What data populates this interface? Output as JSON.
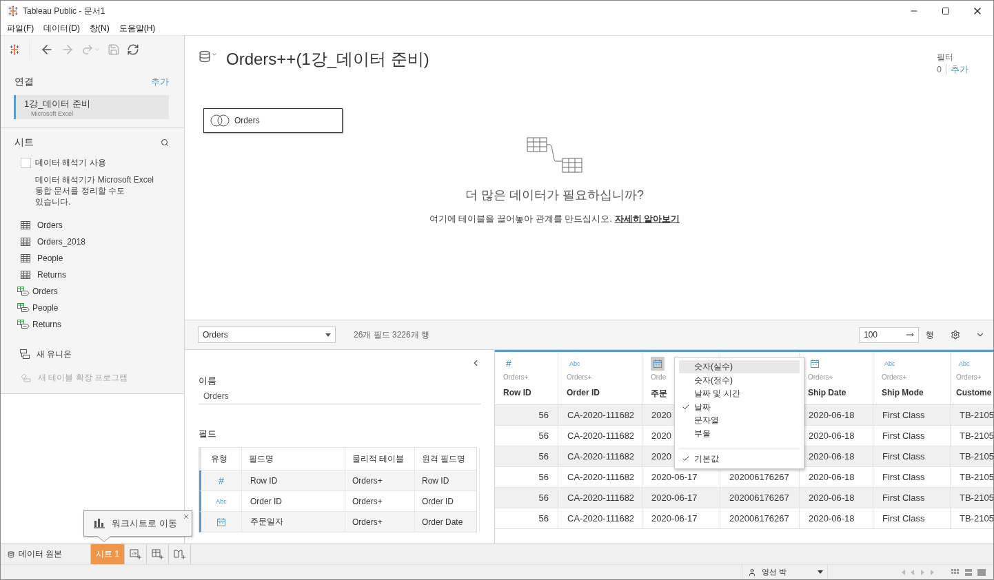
{
  "window": {
    "title": "Tableau Public - 문서1"
  },
  "menu": [
    "파일(F)",
    "데이터(D)",
    "창(N)",
    "도움말(H)"
  ],
  "toolbar": [
    {
      "kind": "back",
      "disabled": false
    },
    {
      "kind": "forward",
      "disabled": true
    },
    {
      "kind": "redo",
      "disabled": true
    },
    {
      "kind": "save",
      "disabled": true
    },
    {
      "kind": "refresh",
      "disabled": false
    }
  ],
  "connections": {
    "title": "연결",
    "add": "추가",
    "items": [
      {
        "name": "1강_데이터 준비",
        "type": "Microsoft Excel",
        "selected": true
      }
    ]
  },
  "sheets": {
    "title": "시트",
    "interpreter": {
      "label": "데이터 해석기 사용",
      "checked": false,
      "description": "데이터 해석기가 Microsoft Excel\n통합 문서를 정리할 수도\n있습니다."
    },
    "items": [
      {
        "name": "Orders",
        "kind": "table"
      },
      {
        "name": "Orders_2018",
        "kind": "table"
      },
      {
        "name": "People",
        "kind": "table"
      },
      {
        "name": "Returns",
        "kind": "table"
      },
      {
        "name": "Orders",
        "kind": "named_range"
      },
      {
        "name": "People",
        "kind": "named_range"
      },
      {
        "name": "Returns",
        "kind": "named_range"
      }
    ],
    "actions": [
      {
        "label": "새 유니온",
        "kind": "union",
        "disabled": false
      },
      {
        "label": "새 테이블 확장 프로그램",
        "kind": "extension",
        "disabled": true
      }
    ]
  },
  "datasource": {
    "title": "Orders++(1강_데이터 준비)",
    "filters": {
      "label": "필터",
      "count": "0",
      "add": "추가"
    }
  },
  "canvas": {
    "tables": [
      {
        "name": "Orders"
      }
    ],
    "heading": "더 많은 데이터가 필요하십니까?",
    "text": "여기에 테이블을 끌어놓아 관계를 만드십시오.",
    "link": "자세히 알아보기"
  },
  "grid_toolbar": {
    "table": "Orders",
    "summary": "26개 필드 3226개 행",
    "rows_value": "100",
    "rows_label": "행"
  },
  "metadata": {
    "name_label": "이름",
    "name": "Orders",
    "fields_label": "필드",
    "columns": [
      "유형",
      "필드명",
      "물리적 테이블",
      "원격 필드명"
    ],
    "rows": [
      {
        "kind": "number",
        "icon": "#",
        "name": "Row ID",
        "table": "Orders+",
        "remote": "Row ID"
      },
      {
        "kind": "string",
        "icon": "Abc",
        "name": "Order ID",
        "table": "Orders+",
        "remote": "Order ID"
      },
      {
        "kind": "date",
        "name": "주문일자",
        "table": "Orders+",
        "remote": "Order Date"
      }
    ]
  },
  "grid": {
    "columns": [
      {
        "kind": "number",
        "icon": "#",
        "source": "Orders+",
        "name": "Row ID"
      },
      {
        "kind": "string",
        "icon": "Abc",
        "source": "Orders+",
        "name": "Order ID"
      },
      {
        "kind": "date",
        "source": "Orde",
        "name": "주문",
        "active": true
      },
      {
        "kind": "none"
      },
      {
        "kind": "date",
        "source": "Orders+",
        "name": "Ship Date"
      },
      {
        "kind": "string",
        "icon": "Abc",
        "source": "Orders+",
        "name": "Ship Mode"
      },
      {
        "kind": "string",
        "icon": "Abc",
        "source": "Orders+",
        "name": "Custome"
      }
    ],
    "rows": [
      [
        "56",
        "CA-2020-111682",
        "2020",
        null,
        "2020-06-18",
        "First Class",
        "TB-2105"
      ],
      [
        "56",
        "CA-2020-111682",
        "2020",
        null,
        "2020-06-18",
        "First Class",
        "TB-2105"
      ],
      [
        "56",
        "CA-2020-111682",
        "2020",
        null,
        "2020-06-18",
        "First Class",
        "TB-2105"
      ],
      [
        "56",
        "CA-2020-111682",
        "2020-06-17",
        "202006176267",
        "2020-06-18",
        "First Class",
        "TB-2105"
      ],
      [
        "56",
        "CA-2020-111682",
        "2020-06-17",
        "202006176267",
        "2020-06-18",
        "First Class",
        "TB-2105"
      ],
      [
        "56",
        "CA-2020-111682",
        "2020-06-17",
        "202006176267",
        "2020-06-18",
        "First Class",
        "TB-2105"
      ]
    ]
  },
  "type_menu": {
    "items": [
      {
        "label": "숫자(실수)",
        "checked": false,
        "selected": true
      },
      {
        "label": "숫자(정수)",
        "checked": false,
        "selected": false
      },
      {
        "label": "날짜 및 시간",
        "checked": false,
        "selected": false
      },
      {
        "label": "날짜",
        "checked": true,
        "selected": false
      },
      {
        "label": "문자열",
        "checked": false,
        "selected": false
      },
      {
        "label": "부울",
        "checked": false,
        "selected": false
      }
    ],
    "footer": {
      "label": "기본값",
      "checked": true
    }
  },
  "tooltip": {
    "text": "워크시트로 이동"
  },
  "tabs": [
    {
      "label": "데이터 원본",
      "kind": "datasource",
      "selected": false
    },
    {
      "label": "시트 1",
      "kind": "sheet",
      "selected": true
    }
  ],
  "status_bar": {
    "user": "영선 박"
  }
}
